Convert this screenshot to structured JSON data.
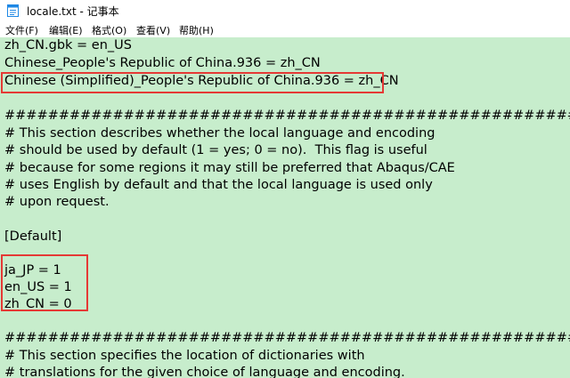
{
  "window": {
    "title": "locale.txt - 记事本"
  },
  "menu": [
    {
      "label": "文件(F)"
    },
    {
      "label": "编辑(E)"
    },
    {
      "label": "格式(O)"
    },
    {
      "label": "查看(V)"
    },
    {
      "label": "帮助(H)"
    }
  ],
  "editor": {
    "background": "#c7edcc",
    "lines": [
      "zh_CN.gbk = en_US",
      "Chinese_People's Republic of China.936 = zh_CN",
      "Chinese (Simplified)_People's Republic of China.936 = zh_CN",
      "",
      "#####################################################################",
      "# This section describes whether the local language and encoding",
      "# should be used by default (1 = yes; 0 = no).  This flag is useful",
      "# because for some regions it may still be preferred that Abaqus/CAE",
      "# uses English by default and that the local language is used only",
      "# upon request.",
      "",
      "[Default]",
      "",
      "ja_JP = 1",
      "en_US = 1",
      "zh_CN = 0",
      "",
      "#####################################################################",
      "# This section specifies the location of dictionaries with",
      "# translations for the given choice of language and encoding."
    ]
  },
  "highlight_color": "#e53935"
}
